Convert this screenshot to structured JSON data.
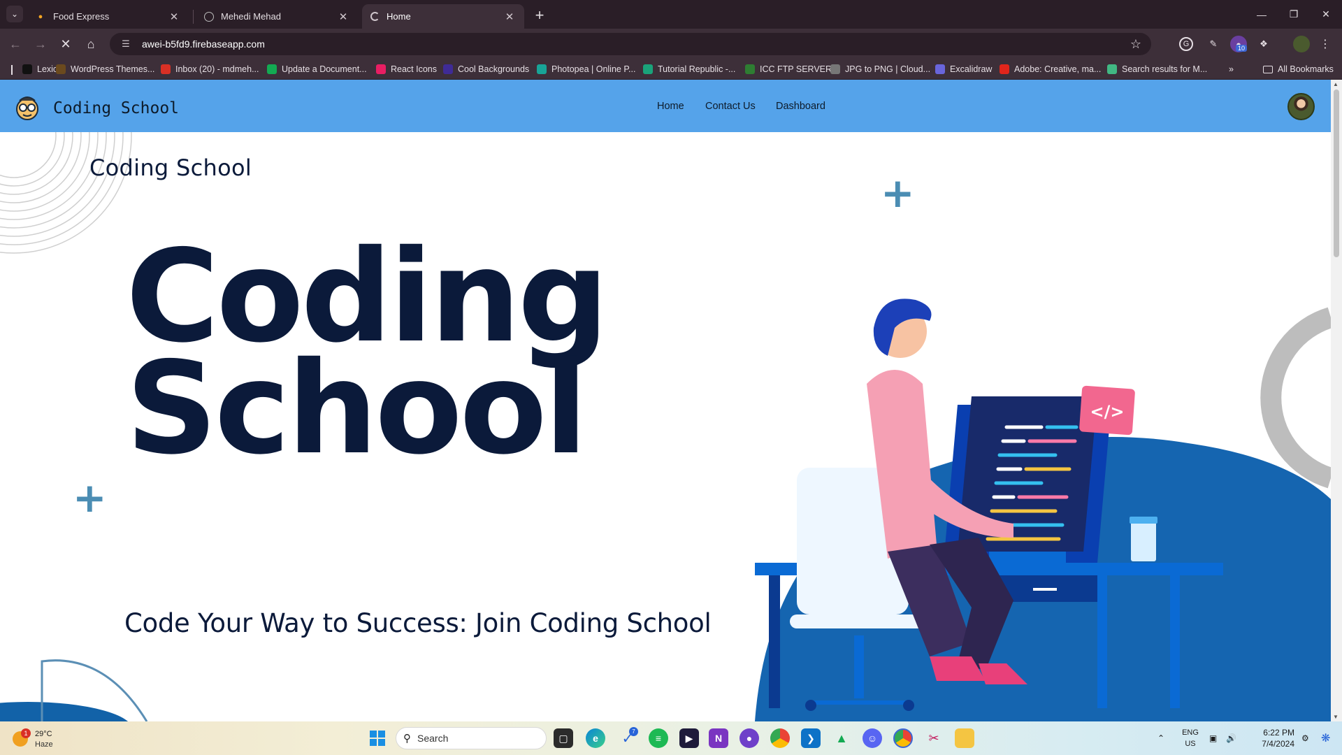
{
  "browser": {
    "tabs": [
      {
        "title": "Food Express",
        "active": false
      },
      {
        "title": "Mehedi Mehad",
        "active": false
      },
      {
        "title": "Home",
        "active": true
      }
    ],
    "url": "awei-b5fd9.firebaseapp.com",
    "extension_badge": "10",
    "bookmarks": [
      {
        "label": "Lexica",
        "icon": "lexica-icon",
        "color": "#111111"
      },
      {
        "label": "WordPress Themes...",
        "icon": "wordpress-icon",
        "color": "#6b4a1e"
      },
      {
        "label": "Inbox (20) - mdmeh...",
        "icon": "gmail-icon",
        "color": "#d93025"
      },
      {
        "label": "Update a Document...",
        "icon": "mongodb-icon",
        "color": "#13aa52"
      },
      {
        "label": "React Icons",
        "icon": "react-icons-icon",
        "color": "#e91e63"
      },
      {
        "label": "Cool Backgrounds",
        "icon": "cool-backgrounds-icon",
        "color": "#3f2b96"
      },
      {
        "label": "Photopea | Online P...",
        "icon": "photopea-icon",
        "color": "#18a497"
      },
      {
        "label": "Tutorial Republic -...",
        "icon": "tutorial-republic-icon",
        "color": "#1aa37a"
      },
      {
        "label": "ICC FTP SERVER",
        "icon": "icc-ftp-icon",
        "color": "#2e7d32"
      },
      {
        "label": "JPG to PNG | Cloud...",
        "icon": "cloud-icon",
        "color": "#777777"
      },
      {
        "label": "Excalidraw",
        "icon": "excalidraw-icon",
        "color": "#6965db"
      },
      {
        "label": "Adobe: Creative, ma...",
        "icon": "adobe-icon",
        "color": "#e1251b"
      },
      {
        "label": "Search results for M...",
        "icon": "vue-icon",
        "color": "#41b883"
      }
    ],
    "all_bookmarks": "All Bookmarks"
  },
  "site": {
    "brand": "Coding School",
    "nav": [
      "Home",
      "Contact Us",
      "Dashboard"
    ],
    "hero_small": "Coding  School",
    "hero_line1": "Coding",
    "hero_line2": "School",
    "tagline": "Code Your Way to Success: Join Coding  School",
    "code_tag": "</>",
    "accent": "#55a3ea",
    "ink": "#0b1a3a"
  },
  "taskbar": {
    "weather": {
      "temp": "29°C",
      "condition": "Haze",
      "badge": "1"
    },
    "search_placeholder": "Search",
    "todo_badge": "7",
    "language": {
      "line1": "ENG",
      "line2": "US"
    },
    "clock": {
      "time": "6:22 PM",
      "date": "7/4/2024"
    }
  }
}
